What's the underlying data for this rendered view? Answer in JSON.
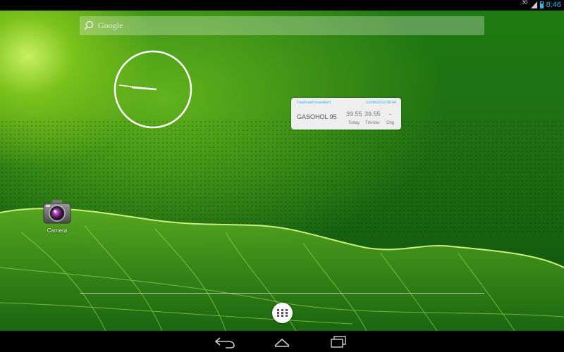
{
  "status_bar": {
    "network": "3G",
    "time": "8:46",
    "accent_color": "#33b5e5"
  },
  "search": {
    "placeholder": "Google",
    "icon": "search-icon"
  },
  "clock_widget": {
    "type": "analog",
    "hour_hand_icon": "clock-hour-hand",
    "minute_hand_icon": "clock-minute-hand"
  },
  "fuel_widget": {
    "app_name": "ThaiFuelPricesAlert",
    "datetime": "10/08/2013 08:44",
    "fuel_type": "GASOHOL 95",
    "today_value": "39.55",
    "tomorrow_value": "39.55",
    "change_value": "-",
    "labels": {
      "today": "Today",
      "tomorrow": "Tmrrow",
      "change": "Chg"
    }
  },
  "shortcuts": [
    {
      "label": "Camera",
      "icon": "camera-icon"
    }
  ],
  "dock": {
    "all_apps_icon": "all-apps-icon"
  },
  "nav_bar": {
    "back_icon": "back-icon",
    "home_icon": "home-icon",
    "recents_icon": "recents-icon"
  }
}
